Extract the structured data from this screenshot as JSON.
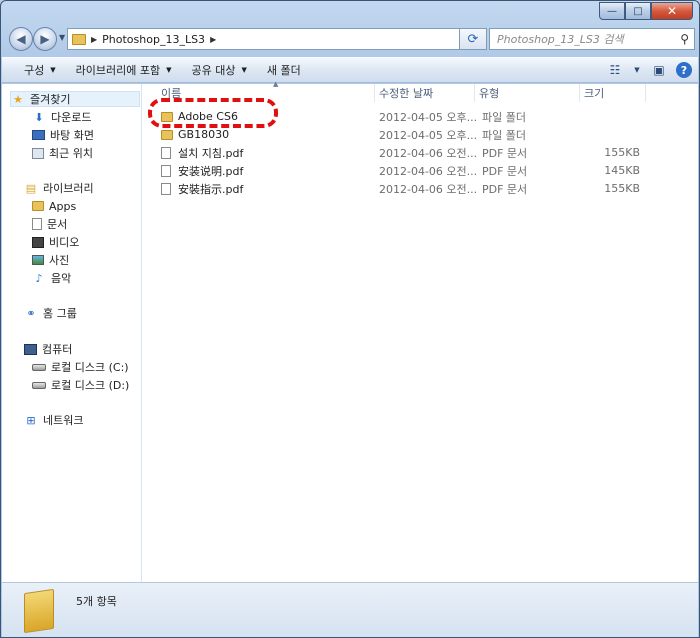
{
  "window": {
    "caption": {
      "minimize": "—",
      "maximize": "□",
      "close": "✕"
    }
  },
  "nav": {
    "back_icon": "◀",
    "forward_icon": "▶",
    "address_path": "Photoshop_13_LS3",
    "search_placeholder": "Photoshop_13_LS3 검색",
    "refresh_icon": "⟳"
  },
  "toolbar": {
    "organize": "구성",
    "include_library": "라이브러리에 포함",
    "share_with": "공유 대상",
    "new_folder": "새 폴더"
  },
  "sidebar": {
    "favorites": "즐겨찾기",
    "downloads": "다운로드",
    "desktop": "바탕 화면",
    "recent": "최근 위치",
    "libraries": "라이브러리",
    "apps": "Apps",
    "documents": "문서",
    "videos": "비디오",
    "pictures": "사진",
    "music": "음악",
    "homegroup": "홈 그룹",
    "computer": "컴퓨터",
    "drive_c": "로컬 디스크 (C:)",
    "drive_d": "로컬 디스크 (D:)",
    "network": "네트워크"
  },
  "columns": {
    "name": "이름",
    "modified": "수정한 날짜",
    "type": "유형",
    "size": "크기"
  },
  "files": [
    {
      "name": "Adobe CS6",
      "date": "2012-04-05 오후...",
      "type": "파일 폴더",
      "size": "",
      "kind": "folder"
    },
    {
      "name": "GB18030",
      "date": "2012-04-05 오후...",
      "type": "파일 폴더",
      "size": "",
      "kind": "folder"
    },
    {
      "name": "설치 지침.pdf",
      "date": "2012-04-06 오전...",
      "type": "PDF 문서",
      "size": "155KB",
      "kind": "pdf"
    },
    {
      "name": "安装说明.pdf",
      "date": "2012-04-06 오전...",
      "type": "PDF 문서",
      "size": "145KB",
      "kind": "pdf"
    },
    {
      "name": "安裝指示.pdf",
      "date": "2012-04-06 오전...",
      "type": "PDF 문서",
      "size": "155KB",
      "kind": "pdf"
    }
  ],
  "details": {
    "item_count": "5개 항목"
  },
  "colors": {
    "annotation": "#e01010",
    "accent": "#2b6cc4"
  }
}
